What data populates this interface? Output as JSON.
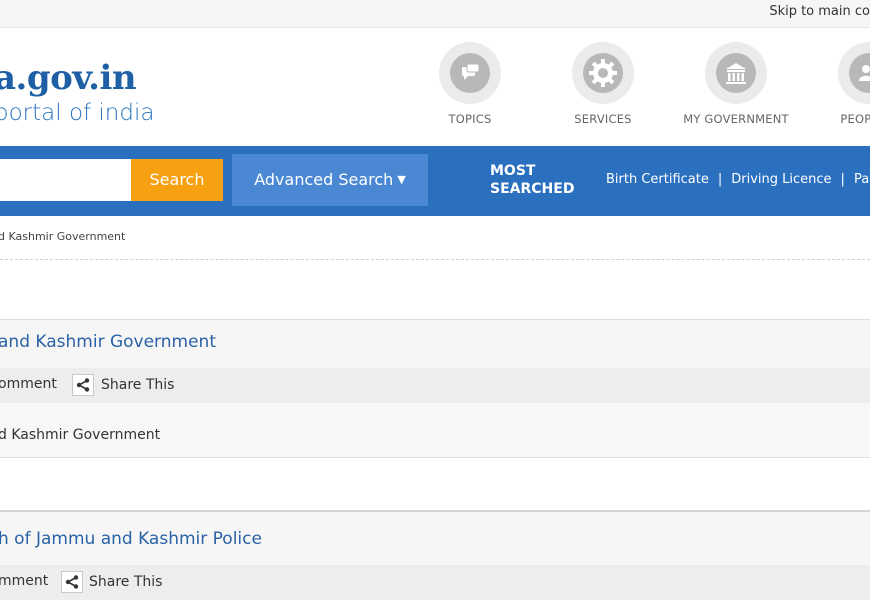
{
  "header": {
    "skip_link": "Skip to main co",
    "logo_domain": "a.gov.in",
    "logo_tagline": "portal of india",
    "nav": [
      {
        "label": "TOPICS",
        "icon": "chat-bubbles-icon"
      },
      {
        "label": "SERVICES",
        "icon": "gear-icon"
      },
      {
        "label": "MY GOVERNMENT",
        "icon": "government-building-icon"
      },
      {
        "label": "PEOPLE C",
        "icon": "people-icon"
      }
    ]
  },
  "search": {
    "input_value": "",
    "button_label": "Search",
    "advanced_label": "Advanced Search",
    "most_searched_line1": "MOST",
    "most_searched_line2": "SEARCHED",
    "links": [
      "Birth Certificate",
      "Driving Licence",
      "Pan ca"
    ],
    "link_separator": "|"
  },
  "breadcrumb": "d Kashmir Government",
  "results": [
    {
      "title": "and Kashmir Government",
      "comment_label": "omment",
      "share_label": "Share This",
      "description": "d Kashmir Government"
    },
    {
      "title": "h of Jammu and Kashmir Police",
      "comment_label": "mment",
      "share_label": "Share This"
    }
  ],
  "colors": {
    "brand_blue": "#2b6fbf",
    "search_orange": "#f7a012",
    "link_blue": "#2a62a6"
  }
}
